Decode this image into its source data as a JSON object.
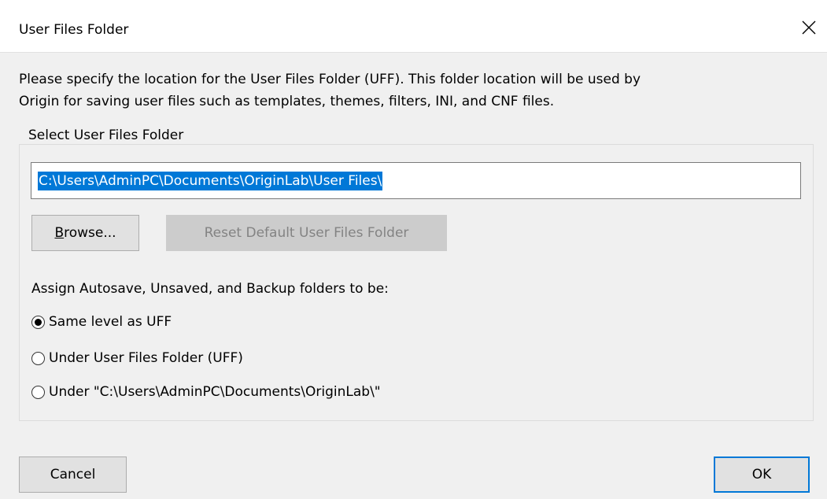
{
  "dialog": {
    "title": "User Files Folder",
    "description_line1": "Please specify the location for the User Files Folder (UFF). This folder location will be used by",
    "description_line2": "Origin for saving user files such as templates, themes, filters, INI, and CNF files."
  },
  "group": {
    "legend": "Select User Files Folder",
    "path_value": "C:\\Users\\AdminPC\\Documents\\OriginLab\\User Files\\",
    "browse_label_mnemonic": "B",
    "browse_label_rest": "rowse...",
    "reset_label": "Reset Default User Files Folder",
    "assign_label": "Assign Autosave, Unsaved, and Backup folders to be:",
    "options": [
      {
        "label": "Same level as UFF",
        "checked": true
      },
      {
        "label": "Under User Files Folder (UFF)",
        "checked": false
      },
      {
        "label": "Under \"C:\\Users\\AdminPC\\Documents\\OriginLab\\\"",
        "checked": false
      }
    ]
  },
  "footer": {
    "cancel_label": "Cancel",
    "ok_label": "OK"
  },
  "icons": {
    "close": "close-icon"
  },
  "colors": {
    "accent": "#0078d7",
    "disabled_text": "#838383"
  }
}
